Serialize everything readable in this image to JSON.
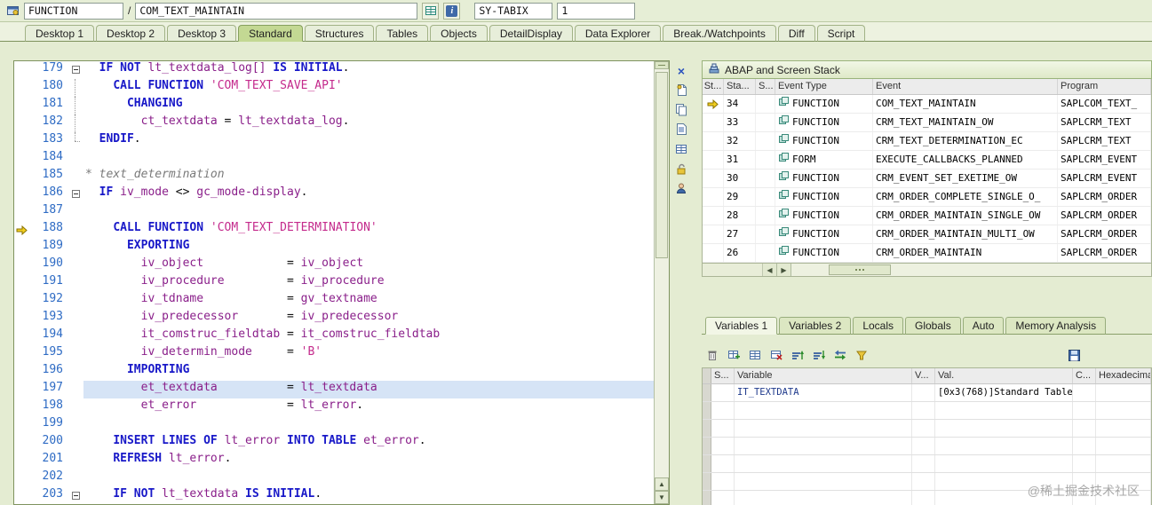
{
  "topbar": {
    "program_type": "FUNCTION",
    "separator": "/",
    "program_name": "COM_TEXT_MAINTAIN",
    "watch_field": "SY-TABIX",
    "watch_value": "1"
  },
  "icons": {
    "close": "×",
    "up_arrow": "▲",
    "down_arrow": "▼",
    "left_arrow": "◀",
    "right_arrow": "▶",
    "info": "i"
  },
  "tabs": [
    {
      "label": "Desktop 1",
      "active": false
    },
    {
      "label": "Desktop 2",
      "active": false
    },
    {
      "label": "Desktop 3",
      "active": false
    },
    {
      "label": "Standard",
      "active": true
    },
    {
      "label": "Structures",
      "active": false
    },
    {
      "label": "Tables",
      "active": false
    },
    {
      "label": "Objects",
      "active": false
    },
    {
      "label": "DetailDisplay",
      "active": false
    },
    {
      "label": "Data Explorer",
      "active": false
    },
    {
      "label": "Break./Watchpoints",
      "active": false
    },
    {
      "label": "Diff",
      "active": false
    },
    {
      "label": "Script",
      "active": false
    }
  ],
  "editor": {
    "current_line": 188,
    "selected_line": 197,
    "lines": [
      {
        "n": 179,
        "f": "box",
        "t": [
          [
            "p",
            "  "
          ],
          [
            "k",
            "IF"
          ],
          [
            "p",
            " "
          ],
          [
            "k",
            "NOT"
          ],
          [
            "p",
            " "
          ],
          [
            "i",
            "lt_textdata_log[]"
          ],
          [
            "p",
            " "
          ],
          [
            "k",
            "IS"
          ],
          [
            "p",
            " "
          ],
          [
            "k",
            "INITIAL"
          ],
          [
            "p",
            "."
          ]
        ]
      },
      {
        "n": 180,
        "f": "line",
        "t": [
          [
            "p",
            "    "
          ],
          [
            "k",
            "CALL"
          ],
          [
            "p",
            " "
          ],
          [
            "k",
            "FUNCTION"
          ],
          [
            "p",
            " "
          ],
          [
            "s",
            "'COM_TEXT_SAVE_API'"
          ]
        ]
      },
      {
        "n": 181,
        "f": "line",
        "t": [
          [
            "p",
            "      "
          ],
          [
            "k",
            "CHANGING"
          ]
        ]
      },
      {
        "n": 182,
        "f": "line",
        "t": [
          [
            "p",
            "        "
          ],
          [
            "i",
            "ct_textdata"
          ],
          [
            "p",
            " = "
          ],
          [
            "i",
            "lt_textdata_log"
          ],
          [
            "p",
            "."
          ]
        ]
      },
      {
        "n": 183,
        "f": "end",
        "t": [
          [
            "p",
            "  "
          ],
          [
            "k",
            "ENDIF"
          ],
          [
            "p",
            "."
          ]
        ]
      },
      {
        "n": 184,
        "f": "",
        "t": []
      },
      {
        "n": 185,
        "f": "",
        "t": [
          [
            "c",
            "* text_determination"
          ]
        ]
      },
      {
        "n": 186,
        "f": "box",
        "t": [
          [
            "p",
            "  "
          ],
          [
            "k",
            "IF"
          ],
          [
            "p",
            " "
          ],
          [
            "i",
            "iv_mode"
          ],
          [
            "p",
            " <> "
          ],
          [
            "i",
            "gc_mode-display"
          ],
          [
            "p",
            "."
          ]
        ]
      },
      {
        "n": 187,
        "f": "",
        "t": []
      },
      {
        "n": 188,
        "f": "",
        "t": [
          [
            "p",
            "    "
          ],
          [
            "k",
            "CALL"
          ],
          [
            "p",
            " "
          ],
          [
            "k",
            "FUNCTION"
          ],
          [
            "p",
            " "
          ],
          [
            "s",
            "'COM_TEXT_DETERMINATION'"
          ]
        ]
      },
      {
        "n": 189,
        "f": "",
        "t": [
          [
            "p",
            "      "
          ],
          [
            "k",
            "EXPORTING"
          ]
        ]
      },
      {
        "n": 190,
        "f": "",
        "t": [
          [
            "p",
            "        "
          ],
          [
            "i",
            "iv_object"
          ],
          [
            "p",
            "            = "
          ],
          [
            "i",
            "iv_object"
          ]
        ]
      },
      {
        "n": 191,
        "f": "",
        "t": [
          [
            "p",
            "        "
          ],
          [
            "i",
            "iv_procedure"
          ],
          [
            "p",
            "         = "
          ],
          [
            "i",
            "iv_procedure"
          ]
        ]
      },
      {
        "n": 192,
        "f": "",
        "t": [
          [
            "p",
            "        "
          ],
          [
            "i",
            "iv_tdname"
          ],
          [
            "p",
            "            = "
          ],
          [
            "i",
            "gv_textname"
          ]
        ]
      },
      {
        "n": 193,
        "f": "",
        "t": [
          [
            "p",
            "        "
          ],
          [
            "i",
            "iv_predecessor"
          ],
          [
            "p",
            "       = "
          ],
          [
            "i",
            "iv_predecessor"
          ]
        ]
      },
      {
        "n": 194,
        "f": "",
        "t": [
          [
            "p",
            "        "
          ],
          [
            "i",
            "it_comstruc_fieldtab"
          ],
          [
            "p",
            " = "
          ],
          [
            "i",
            "it_comstruc_fieldtab"
          ]
        ]
      },
      {
        "n": 195,
        "f": "",
        "t": [
          [
            "p",
            "        "
          ],
          [
            "i",
            "iv_determin_mode"
          ],
          [
            "p",
            "     = "
          ],
          [
            "s",
            "'B'"
          ]
        ]
      },
      {
        "n": 196,
        "f": "",
        "t": [
          [
            "p",
            "      "
          ],
          [
            "k",
            "IMPORTING"
          ]
        ]
      },
      {
        "n": 197,
        "f": "",
        "t": [
          [
            "p",
            "        "
          ],
          [
            "i",
            "et_textdata"
          ],
          [
            "p",
            "          = "
          ],
          [
            "i",
            "lt_textdata"
          ]
        ]
      },
      {
        "n": 198,
        "f": "",
        "t": [
          [
            "p",
            "        "
          ],
          [
            "i",
            "et_error"
          ],
          [
            "p",
            "             = "
          ],
          [
            "i",
            "lt_error"
          ],
          [
            "p",
            "."
          ]
        ]
      },
      {
        "n": 199,
        "f": "",
        "t": []
      },
      {
        "n": 200,
        "f": "",
        "t": [
          [
            "p",
            "    "
          ],
          [
            "k",
            "INSERT"
          ],
          [
            "p",
            " "
          ],
          [
            "k",
            "LINES"
          ],
          [
            "p",
            " "
          ],
          [
            "k",
            "OF"
          ],
          [
            "p",
            " "
          ],
          [
            "i",
            "lt_error"
          ],
          [
            "p",
            " "
          ],
          [
            "k",
            "INTO"
          ],
          [
            "p",
            " "
          ],
          [
            "k",
            "TABLE"
          ],
          [
            "p",
            " "
          ],
          [
            "i",
            "et_error"
          ],
          [
            "p",
            "."
          ]
        ]
      },
      {
        "n": 201,
        "f": "",
        "t": [
          [
            "p",
            "    "
          ],
          [
            "k",
            "REFRESH"
          ],
          [
            "p",
            " "
          ],
          [
            "i",
            "lt_error"
          ],
          [
            "p",
            "."
          ]
        ]
      },
      {
        "n": 202,
        "f": "",
        "t": []
      },
      {
        "n": 203,
        "f": "box",
        "t": [
          [
            "p",
            "    "
          ],
          [
            "k",
            "IF"
          ],
          [
            "p",
            " "
          ],
          [
            "k",
            "NOT"
          ],
          [
            "p",
            " "
          ],
          [
            "i",
            "lt_textdata"
          ],
          [
            "p",
            " "
          ],
          [
            "k",
            "IS"
          ],
          [
            "p",
            " "
          ],
          [
            "k",
            "INITIAL"
          ],
          [
            "p",
            "."
          ]
        ]
      }
    ]
  },
  "stack_panel": {
    "title": "ABAP and Screen Stack",
    "columns": [
      "St...",
      "Sta...",
      "S...",
      "Event Type",
      "Event",
      "Program"
    ],
    "rows": [
      {
        "current": true,
        "level": "34",
        "type": "FUNCTION",
        "event": "COM_TEXT_MAINTAIN",
        "program": "SAPLCOM_TEXT_"
      },
      {
        "current": false,
        "level": "33",
        "type": "FUNCTION",
        "event": "CRM_TEXT_MAINTAIN_OW",
        "program": "SAPLCRM_TEXT"
      },
      {
        "current": false,
        "level": "32",
        "type": "FUNCTION",
        "event": "CRM_TEXT_DETERMINATION_EC",
        "program": "SAPLCRM_TEXT"
      },
      {
        "current": false,
        "level": "31",
        "type": "FORM",
        "event": "EXECUTE_CALLBACKS_PLANNED",
        "program": "SAPLCRM_EVENT"
      },
      {
        "current": false,
        "level": "30",
        "type": "FUNCTION",
        "event": "CRM_EVENT_SET_EXETIME_OW",
        "program": "SAPLCRM_EVENT"
      },
      {
        "current": false,
        "level": "29",
        "type": "FUNCTION",
        "event": "CRM_ORDER_COMPLETE_SINGLE_O_",
        "program": "SAPLCRM_ORDER"
      },
      {
        "current": false,
        "level": "28",
        "type": "FUNCTION",
        "event": "CRM_ORDER_MAINTAIN_SINGLE_OW",
        "program": "SAPLCRM_ORDER"
      },
      {
        "current": false,
        "level": "27",
        "type": "FUNCTION",
        "event": "CRM_ORDER_MAINTAIN_MULTI_OW",
        "program": "SAPLCRM_ORDER"
      },
      {
        "current": false,
        "level": "26",
        "type": "FUNCTION",
        "event": "CRM_ORDER_MAINTAIN",
        "program": "SAPLCRM_ORDER"
      }
    ]
  },
  "variables_panel": {
    "tabs": [
      {
        "label": "Variables 1",
        "active": true
      },
      {
        "label": "Variables 2",
        "active": false
      },
      {
        "label": "Locals",
        "active": false
      },
      {
        "label": "Globals",
        "active": false
      },
      {
        "label": "Auto",
        "active": false
      },
      {
        "label": "Memory Analysis",
        "active": false
      }
    ],
    "columns": [
      "S...",
      "Variable",
      "V...",
      "Val.",
      "C...",
      "Hexadecimal V"
    ],
    "rows": [
      {
        "variable": "IT_TEXTDATA",
        "value": "[0x3(768)]Standard Table"
      }
    ],
    "empty_rows": 6
  },
  "watermark": "@稀土掘金技术社区"
}
